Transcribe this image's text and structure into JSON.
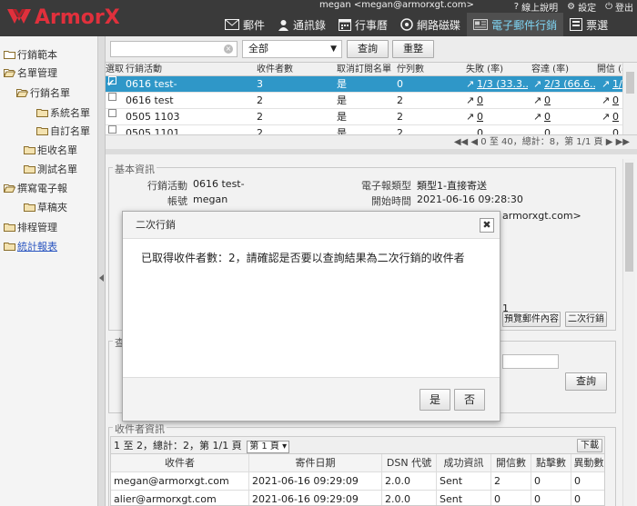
{
  "header": {
    "brand": "ArmorX",
    "user": "megan <megan@armorxgt.com>",
    "top_links": [
      {
        "label": "線上說明",
        "icon": "question-icon"
      },
      {
        "label": "設定",
        "icon": "gear-icon"
      },
      {
        "label": "登出",
        "icon": "power-icon"
      }
    ],
    "tabs": [
      {
        "label": "郵件",
        "icon": "mail-icon"
      },
      {
        "label": "通訊錄",
        "icon": "contacts-icon"
      },
      {
        "label": "行事曆",
        "icon": "calendar-icon"
      },
      {
        "label": "網路磁碟",
        "icon": "disk-icon"
      },
      {
        "label": "電子郵件行銷",
        "icon": "marketing-icon",
        "active": true
      },
      {
        "label": "票選",
        "icon": "vote-icon"
      }
    ]
  },
  "sidebar": {
    "items": [
      {
        "label": "行銷範本",
        "level": 0,
        "folder": true
      },
      {
        "label": "名單管理",
        "level": 0,
        "folder": true
      },
      {
        "label": "行銷名單",
        "level": 1,
        "folder": true
      },
      {
        "label": "系統名單",
        "level": 2,
        "folder": true
      },
      {
        "label": "自訂名單",
        "level": 2,
        "folder": true
      },
      {
        "label": "拒收名單",
        "level": 1,
        "folder": true
      },
      {
        "label": "測試名單",
        "level": 1,
        "folder": true
      },
      {
        "label": "撰寫電子報",
        "level": 0,
        "folder": true
      },
      {
        "label": "草稿夾",
        "level": 1,
        "folder": true
      },
      {
        "label": "排程管理",
        "level": 0,
        "folder": true
      },
      {
        "label": "統計報表",
        "level": 0,
        "folder": true,
        "link": true
      }
    ]
  },
  "search": {
    "input_value": "",
    "select_value": "全部",
    "search_label": "查詢",
    "reset_label": "重整"
  },
  "campaign_table": {
    "headers": [
      "選取",
      "行銷活動",
      "收件者數",
      "取消訂閱名單",
      "佇列數",
      "失敗 (率)",
      "容達 (率)",
      "開信 (率)"
    ],
    "rows": [
      {
        "selected": true,
        "name": "0616 test-",
        "recipients": "3",
        "unsub": "是",
        "queue": "0",
        "fail": "1/3 (33.3...",
        "reach": "2/3 (66.6...",
        "open": "1/"
      },
      {
        "selected": false,
        "name": "0616 test",
        "recipients": "2",
        "unsub": "是",
        "queue": "2",
        "fail": "0",
        "reach": "0",
        "open": "0"
      },
      {
        "selected": false,
        "name": "0505 1103",
        "recipients": "2",
        "unsub": "是",
        "queue": "2",
        "fail": "0",
        "reach": "0",
        "open": "0"
      },
      {
        "selected": false,
        "name": "0505 1101",
        "recipients": "2",
        "unsub": "是",
        "queue": "2",
        "fail": "0",
        "reach": "0",
        "open": "0"
      }
    ],
    "pager": "0 至 40，總計：8，第 1/1 頁"
  },
  "detail": {
    "legend": "基本資訊",
    "campaign_label": "行銷活動",
    "campaign_value": "0616 test-",
    "account_label": "帳號",
    "account_value": "megan",
    "type_label": "電子報類型",
    "type_value": "類型1-直接寄送",
    "start_label": "開始時間",
    "start_value": "2021-06-16 09:28:30",
    "sender_partial": "armorxgt.com>",
    "count_partial": "1",
    "preview_label": "預覽郵件內容",
    "second_label": "二次行銷",
    "query_legend": "查",
    "query_btn": "查詢"
  },
  "recipients": {
    "legend": "收件者資訊",
    "pager_text": "1 至 2，總計：2，第 1/1 頁",
    "page_select": "第 1 頁",
    "download_label": "下載",
    "headers": [
      "收件者",
      "寄件日期",
      "DSN 代號",
      "成功資訊",
      "開信數",
      "點擊數",
      "異動數"
    ],
    "rows": [
      [
        "megan@armorxgt.com",
        "2021-06-16 09:29:09",
        "2.0.0",
        "Sent",
        "2",
        "0",
        "0"
      ],
      [
        "alier@armorxgt.com",
        "2021-06-16 09:29:09",
        "2.0.0",
        "Sent",
        "0",
        "0",
        "0"
      ]
    ]
  },
  "modal": {
    "title": "二次行銷",
    "message": "已取得收件者數：2，請確認是否要以查詢結果為二次行銷的收件者",
    "yes_label": "是",
    "no_label": "否",
    "close_label": "✖"
  },
  "colors": {
    "brand_red": "#e0303c",
    "header_bg": "#3a3a3a",
    "selected_row": "#2f97c8",
    "active_tab_text": "#7fd6f5"
  }
}
